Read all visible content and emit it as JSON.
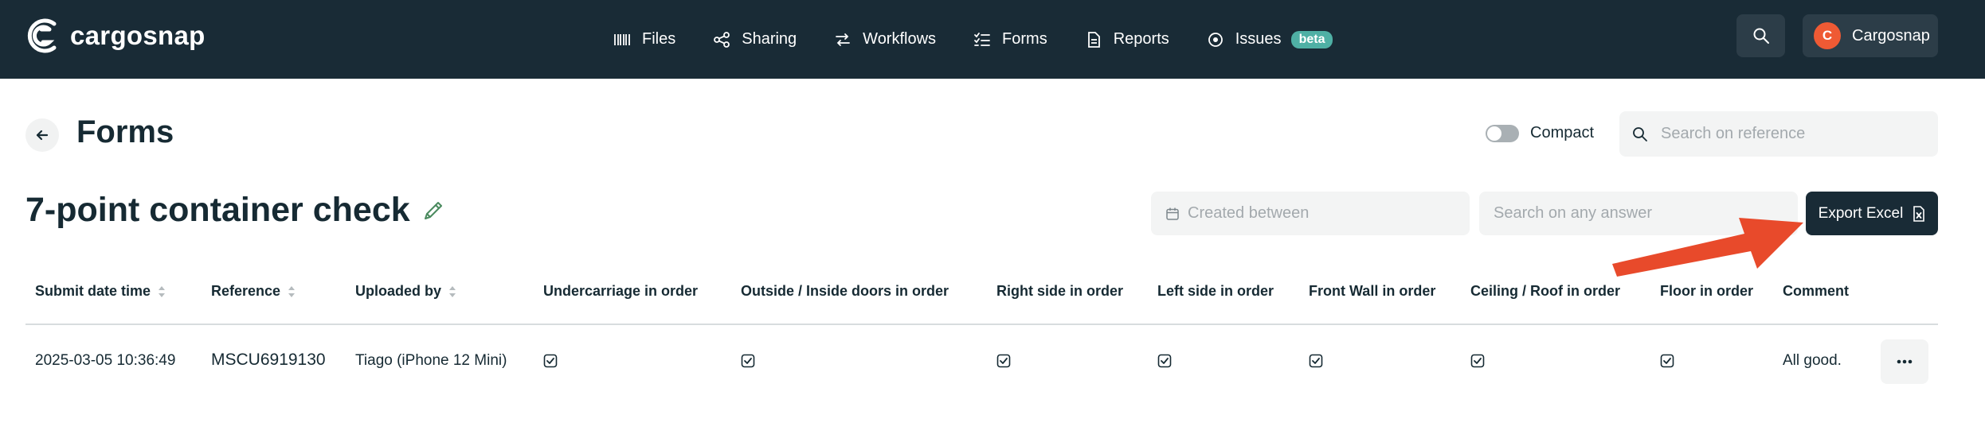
{
  "app": {
    "name": "cargosnap",
    "colors": {
      "topbar": "#192b36",
      "accent": "#ef5a34",
      "badge": "#4fb0a5",
      "arrow": "#e84a2b"
    }
  },
  "nav": {
    "items": [
      {
        "label": "Files",
        "icon": "barcode-icon"
      },
      {
        "label": "Sharing",
        "icon": "share-icon"
      },
      {
        "label": "Workflows",
        "icon": "workflow-icon"
      },
      {
        "label": "Forms",
        "icon": "checklist-icon"
      },
      {
        "label": "Reports",
        "icon": "report-icon"
      },
      {
        "label": "Issues",
        "icon": "issues-icon",
        "badge": "beta"
      }
    ]
  },
  "account": {
    "initial": "C",
    "name": "Cargosnap"
  },
  "page": {
    "title": "Forms"
  },
  "compact": {
    "label": "Compact",
    "enabled": false
  },
  "reference_search": {
    "placeholder": "Search on reference"
  },
  "form": {
    "title": "7-point container check"
  },
  "filters": {
    "date_placeholder": "Created between",
    "answer_placeholder": "Search on any answer"
  },
  "export": {
    "label": "Export Excel"
  },
  "table": {
    "columns": [
      {
        "label": "Submit date time",
        "sortable": true
      },
      {
        "label": "Reference",
        "sortable": true
      },
      {
        "label": "Uploaded by",
        "sortable": true
      },
      {
        "label": "Undercarriage in order",
        "sortable": false
      },
      {
        "label": "Outside / Inside doors in order",
        "sortable": false
      },
      {
        "label": "Right side in order",
        "sortable": false
      },
      {
        "label": "Left side in order",
        "sortable": false
      },
      {
        "label": "Front Wall in order",
        "sortable": false
      },
      {
        "label": "Ceiling / Roof in order",
        "sortable": false
      },
      {
        "label": "Floor in order",
        "sortable": false
      },
      {
        "label": "Comment",
        "sortable": false
      }
    ],
    "rows": [
      {
        "submit_date_time": "2025-03-05 10:36:49",
        "reference": "MSCU6919130",
        "uploaded_by": "Tiago (iPhone 12 Mini)",
        "undercarriage": true,
        "doors": true,
        "right_side": true,
        "left_side": true,
        "front_wall": true,
        "ceiling_roof": true,
        "floor": true,
        "comment": "All good."
      }
    ]
  }
}
